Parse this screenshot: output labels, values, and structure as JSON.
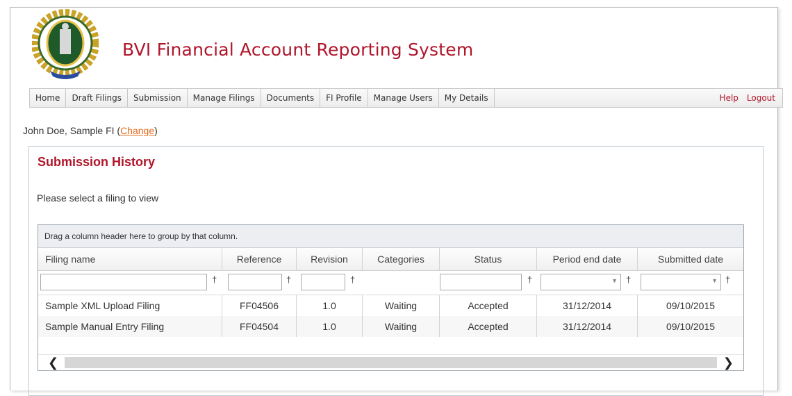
{
  "app": {
    "title": "BVI Financial Account Reporting System"
  },
  "nav": {
    "items": [
      "Home",
      "Draft Filings",
      "Submission",
      "Manage Filings",
      "Documents",
      "FI Profile",
      "Manage Users",
      "My Details"
    ],
    "help": "Help",
    "logout": "Logout"
  },
  "user": {
    "prefix": "John Doe, Sample FI (",
    "change_link": "Change",
    "suffix": ")"
  },
  "page": {
    "title": "Submission History",
    "instruction": "Please select a filing to view"
  },
  "grid": {
    "group_hint": "Drag a column header here to group by that column.",
    "columns": [
      "Filing name",
      "Reference",
      "Revision",
      "Categories",
      "Status",
      "Period end date",
      "Submitted date"
    ],
    "rows": [
      [
        "Sample XML Upload Filing",
        "FF04506",
        "1.0",
        "Waiting",
        "Accepted",
        "31/12/2014",
        "09/10/2015"
      ],
      [
        "Sample Manual Entry Filing",
        "FF04504",
        "1.0",
        "Waiting",
        "Accepted",
        "31/12/2014",
        "09/10/2015"
      ]
    ]
  },
  "colors": {
    "brand_red": "#b0162b",
    "link_orange": "#e36b1b"
  }
}
